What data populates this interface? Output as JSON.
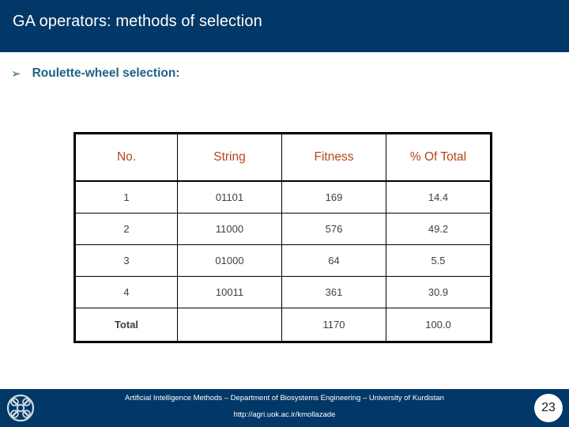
{
  "slide": {
    "title": "GA operators: methods of selection",
    "bullet": {
      "marker": "➢",
      "marker_icon": "chevron-right-bullet-icon",
      "text": "Roulette-wheel selection:"
    }
  },
  "colors": {
    "band_navy": "#023867",
    "title_text": "#ffffff",
    "bullet_text": "#1f6285",
    "bullet_marker": "#2d6a86",
    "table_header_text": "#b5441a",
    "table_border": "#000000",
    "table_body_text": "#404040",
    "muted_text": "#6f7d8c"
  },
  "table": {
    "columns": [
      "No.",
      "String",
      "Fitness",
      "% Of Total"
    ],
    "rows": [
      {
        "no": "1",
        "string": "01101",
        "fitness": "169",
        "percent": "14.4"
      },
      {
        "no": "2",
        "string": "11000",
        "fitness": "576",
        "percent": "49.2"
      },
      {
        "no": "3",
        "string": "01000",
        "fitness": "64",
        "percent": "5.5"
      },
      {
        "no": "4",
        "string": "10011",
        "fitness": "361",
        "percent": "30.9"
      }
    ],
    "total_row": {
      "label": "Total",
      "string": "",
      "fitness": "1170",
      "percent": "100.0"
    }
  },
  "footer": {
    "logo_icon": "university-emblem-icon",
    "line1": "Artificial Intelligence Methods – Department of Biosystems Engineering – University of Kurdistan",
    "line2": "http://agri.uok.ac.ir/kmollazade",
    "page_number": "23"
  }
}
